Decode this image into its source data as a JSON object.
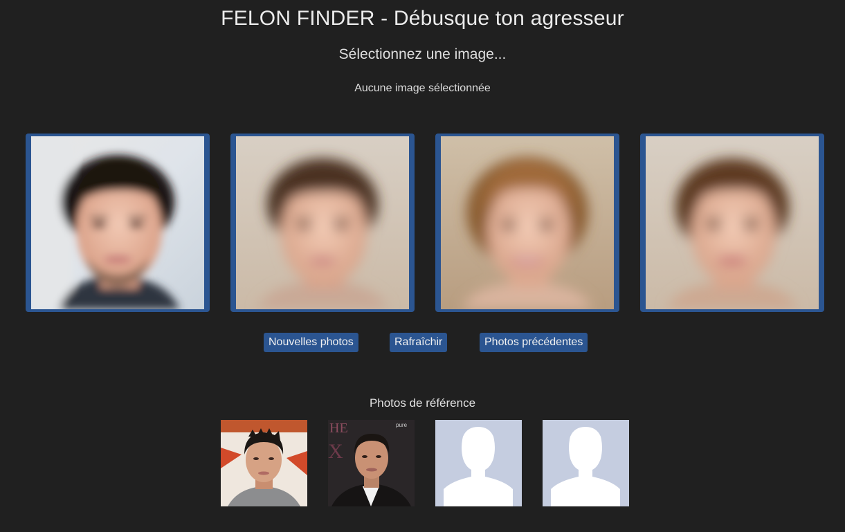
{
  "header": {
    "title": "FELON FINDER - Débusque ton agresseur",
    "select_prompt": "Sélectionnez une image...",
    "selection_status": "Aucune image sélectionnée"
  },
  "candidates": [
    {
      "icon": "generated-face-man-photo"
    },
    {
      "icon": "generated-face-blend-photo"
    },
    {
      "icon": "generated-face-woman-photo"
    },
    {
      "icon": "generated-face-blend-photo"
    }
  ],
  "actions": {
    "new_photos": "Nouvelles photos",
    "refresh": "Rafraîchir",
    "previous_photos": "Photos précédentes"
  },
  "reference": {
    "title": "Photos de référence",
    "photos": [
      {
        "icon": "reference-portrait-photo"
      },
      {
        "icon": "reference-portrait-photo"
      },
      {
        "icon": "empty-avatar-placeholder-icon"
      },
      {
        "icon": "empty-avatar-placeholder-icon"
      }
    ],
    "tiny_caption": "pure"
  },
  "colors": {
    "background": "#202020",
    "accent": "#2b5591",
    "placeholder_bg": "#c5cde0"
  }
}
